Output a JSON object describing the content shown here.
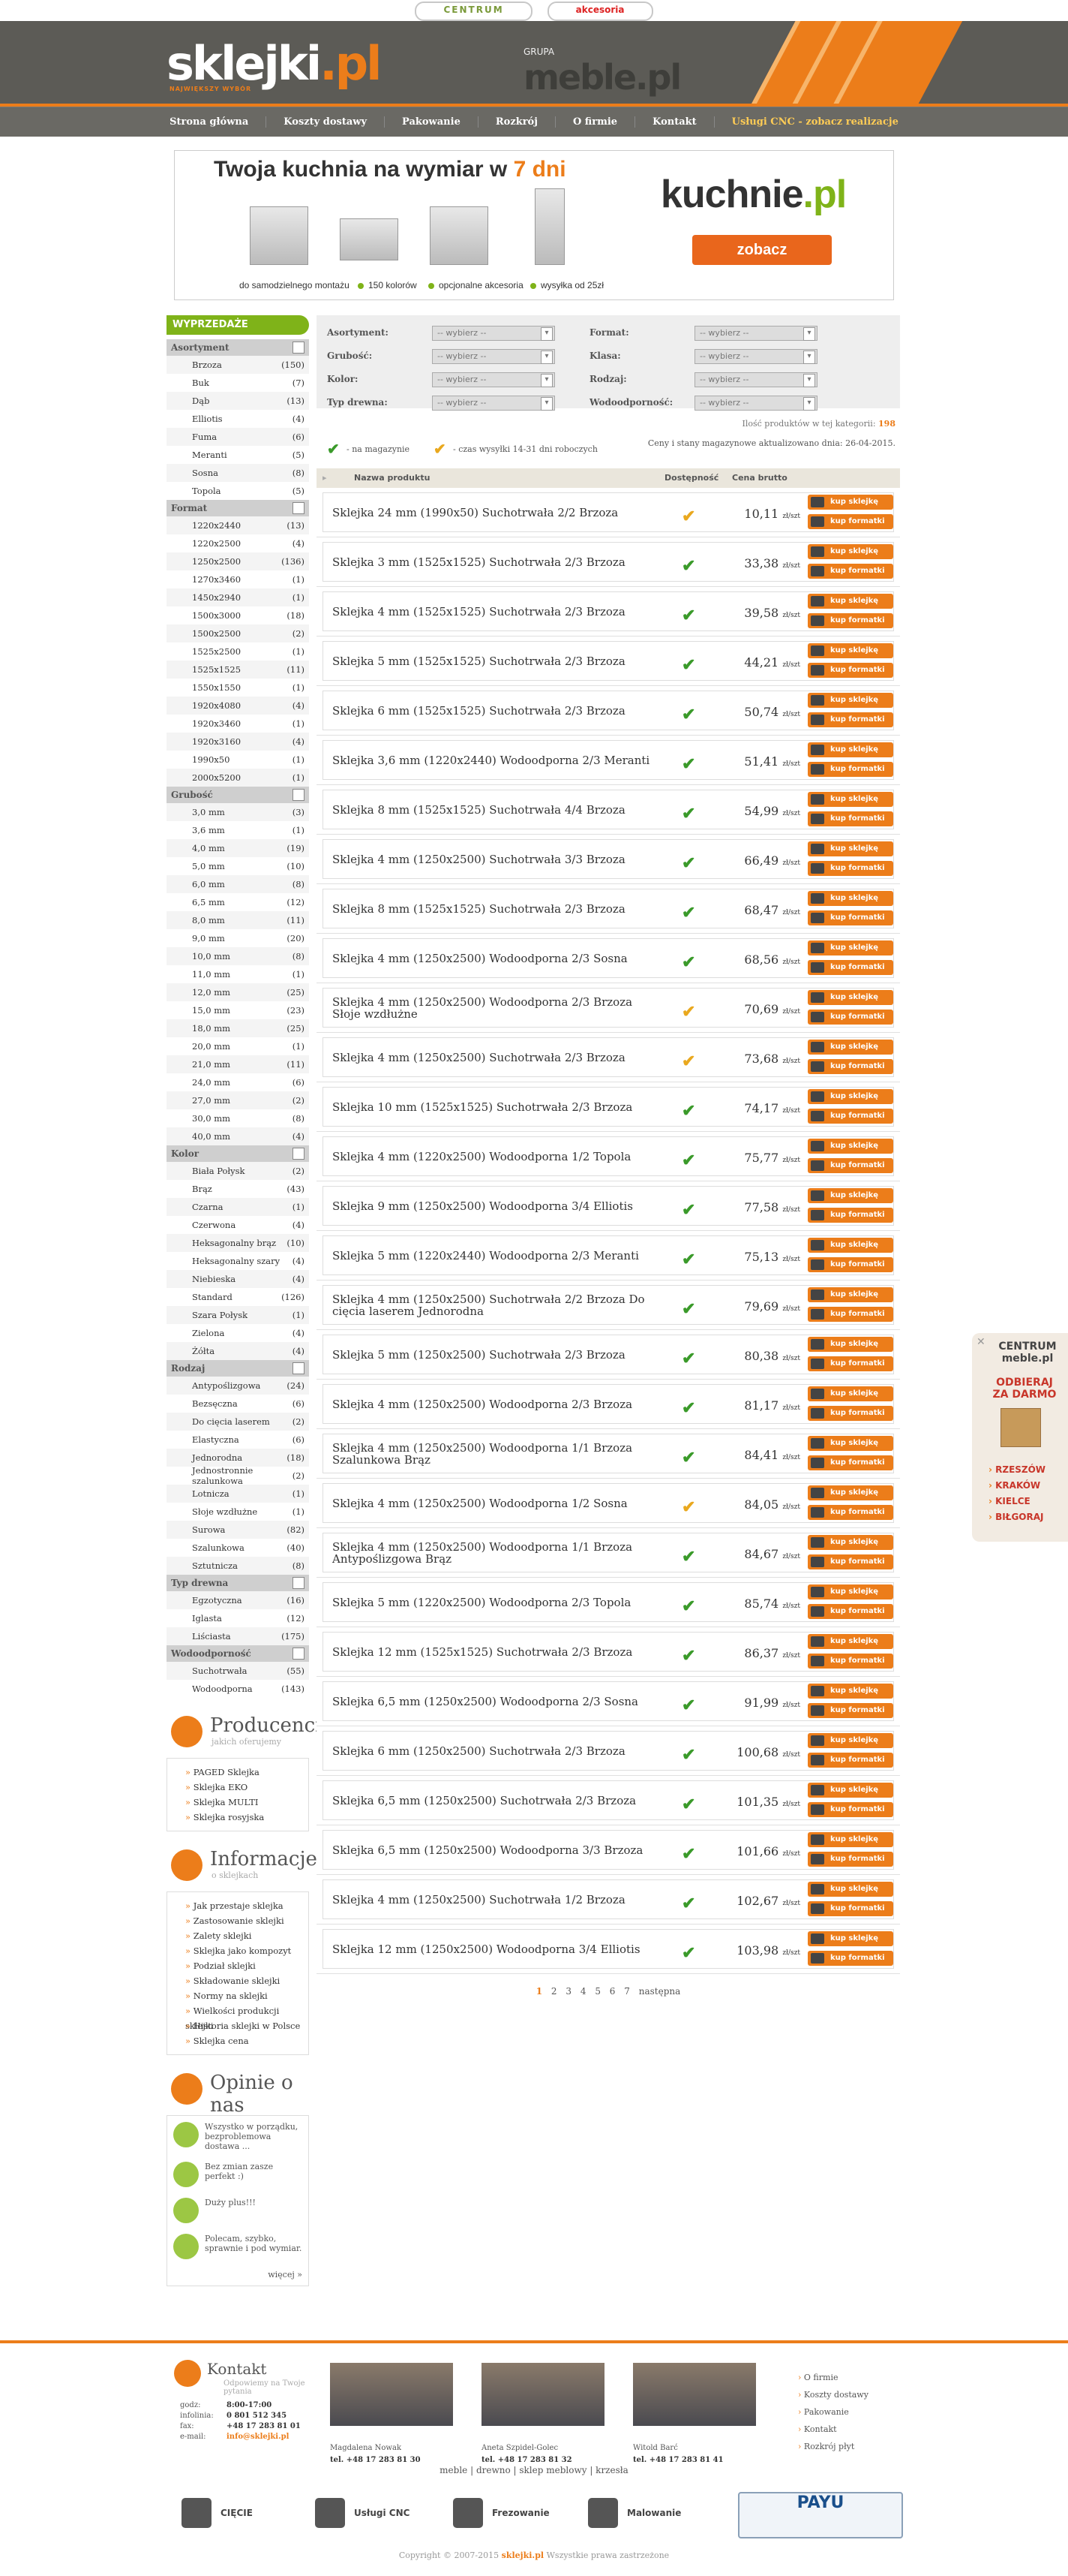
{
  "top": {
    "centrum": "CENTRUM",
    "akcesoria": "akcesoria"
  },
  "header": {
    "logo": "sklejki",
    "logo_dot": ".pl",
    "tagline": "NAJWIĘKSZY WYBÓR",
    "grupa": "GRUPA",
    "meble": "meble.pl"
  },
  "nav": [
    "Strona główna",
    "Koszty dostawy",
    "Pakowanie",
    "Rozkrój",
    "O firmie",
    "Kontakt",
    "Usługi CNC - zobacz realizacje"
  ],
  "banner": {
    "title": "Twoja kuchnia na wymiar w ",
    "title_accent": "7 dni",
    "features": [
      "do samodzielnego montażu",
      "150 kolorów",
      "opcjonalne akcesoria",
      "wysyłka od 25zł"
    ],
    "brand": "kuchnie",
    "brand_dot": ".pl",
    "cta": "zobacz"
  },
  "sidebar": {
    "sale": "WYPRZEDAŻE",
    "groups": [
      {
        "title": "Asortyment",
        "items": [
          [
            "Brzoza",
            "(150)"
          ],
          [
            "Buk",
            "(7)"
          ],
          [
            "Dąb",
            "(13)"
          ],
          [
            "Elliotis",
            "(4)"
          ],
          [
            "Fuma",
            "(6)"
          ],
          [
            "Meranti",
            "(5)"
          ],
          [
            "Sosna",
            "(8)"
          ],
          [
            "Topola",
            "(5)"
          ]
        ]
      },
      {
        "title": "Format",
        "items": [
          [
            "1220x2440",
            "(13)"
          ],
          [
            "1220x2500",
            "(4)"
          ],
          [
            "1250x2500",
            "(136)"
          ],
          [
            "1270x3460",
            "(1)"
          ],
          [
            "1450x2940",
            "(1)"
          ],
          [
            "1500x3000",
            "(18)"
          ],
          [
            "1500x2500",
            "(2)"
          ],
          [
            "1525x2500",
            "(1)"
          ],
          [
            "1525x1525",
            "(11)"
          ],
          [
            "1550x1550",
            "(1)"
          ],
          [
            "1920x4080",
            "(4)"
          ],
          [
            "1920x3460",
            "(1)"
          ],
          [
            "1920x3160",
            "(4)"
          ],
          [
            "1990x50",
            "(1)"
          ],
          [
            "2000x5200",
            "(1)"
          ]
        ]
      },
      {
        "title": "Grubość",
        "items": [
          [
            "3,0 mm",
            "(3)"
          ],
          [
            "3,6 mm",
            "(1)"
          ],
          [
            "4,0 mm",
            "(19)"
          ],
          [
            "5,0 mm",
            "(10)"
          ],
          [
            "6,0 mm",
            "(8)"
          ],
          [
            "6,5 mm",
            "(12)"
          ],
          [
            "8,0 mm",
            "(11)"
          ],
          [
            "9,0 mm",
            "(20)"
          ],
          [
            "10,0 mm",
            "(8)"
          ],
          [
            "11,0 mm",
            "(1)"
          ],
          [
            "12,0 mm",
            "(25)"
          ],
          [
            "15,0 mm",
            "(23)"
          ],
          [
            "18,0 mm",
            "(25)"
          ],
          [
            "20,0 mm",
            "(1)"
          ],
          [
            "21,0 mm",
            "(11)"
          ],
          [
            "24,0 mm",
            "(6)"
          ],
          [
            "27,0 mm",
            "(2)"
          ],
          [
            "30,0 mm",
            "(8)"
          ],
          [
            "40,0 mm",
            "(4)"
          ]
        ]
      },
      {
        "title": "Kolor",
        "items": [
          [
            "Biała Połysk",
            "(2)"
          ],
          [
            "Brąz",
            "(43)"
          ],
          [
            "Czarna",
            "(1)"
          ],
          [
            "Czerwona",
            "(4)"
          ],
          [
            "Heksagonalny brąz",
            "(10)"
          ],
          [
            "Heksagonalny szary",
            "(4)"
          ],
          [
            "Niebieska",
            "(4)"
          ],
          [
            "Standard",
            "(126)"
          ],
          [
            "Szara Połysk",
            "(1)"
          ],
          [
            "Zielona",
            "(4)"
          ],
          [
            "Żółta",
            "(4)"
          ]
        ]
      },
      {
        "title": "Rodzaj",
        "items": [
          [
            "Antypoślizgowa",
            "(24)"
          ],
          [
            "Bezsęcznа",
            "(6)"
          ],
          [
            "Do cięcia laserem",
            "(2)"
          ],
          [
            "Elastyczna",
            "(6)"
          ],
          [
            "Jednorodna",
            "(18)"
          ],
          [
            "Jednostronnie szalunkowa",
            "(2)"
          ],
          [
            "Lotnicza",
            "(1)"
          ],
          [
            "Słoje wzdłużne",
            "(1)"
          ],
          [
            "Surowa",
            "(82)"
          ],
          [
            "Szalunkowa",
            "(40)"
          ],
          [
            "Sztutnicza",
            "(8)"
          ]
        ]
      },
      {
        "title": "Typ drewna",
        "items": [
          [
            "Egzotyczna",
            "(16)"
          ],
          [
            "Iglasta",
            "(12)"
          ],
          [
            "Liściasta",
            "(175)"
          ]
        ]
      },
      {
        "title": "Wodoodporność",
        "items": [
          [
            "Suchotrwała",
            "(55)"
          ],
          [
            "Wodoodporna",
            "(143)"
          ]
        ]
      }
    ],
    "producenci": {
      "title": "Producenci",
      "sub": "jakich oferujemy",
      "items": [
        "PAGED Sklejka",
        "Sklejka EKO",
        "Sklejka MULTI",
        "Sklejka rosyjska"
      ]
    },
    "informacje": {
      "title": "Informacje",
      "sub": "o sklejkach",
      "items": [
        "Jak przestaje sklejka",
        "Zastosowanie sklejki",
        "Zalety sklejki",
        "Sklejka jako kompozyt",
        "Podział sklejki",
        "Składowanie sklejki",
        "Normy na sklejki",
        "Wielkości produkcji sklejki",
        "Historia sklejki w Polsce",
        "Sklejka cena"
      ]
    },
    "opinie": {
      "title": "Opinie o nas",
      "items": [
        "Wszystko w porządku, bezproblemowa dostawa ...",
        "Bez zmian zasze perfekt :)",
        "Duży plus!!!",
        "Polecam, szybko, sprawnie i pod wymiar."
      ],
      "more": "więcej »"
    }
  },
  "filters": {
    "labels": [
      "Asortyment:",
      "Grubość:",
      "Kolor:",
      "Typ drewna:",
      "Format:",
      "Klasa:",
      "Rodzaj:",
      "Wodoodporność:"
    ],
    "placeholder": "-- wybierz --"
  },
  "count": {
    "text": "Ilość produktów w tej kategorii:",
    "value": "198"
  },
  "legend": {
    "in_stock": "- na magazynie",
    "wait": "- czas wysyłki 14-31 dni roboczych",
    "updated": "Ceny i stany magazynowe aktualizowano dnia: 26-04-2015."
  },
  "table": {
    "h_name": "Nazwa produktu",
    "h_avail": "Dostępność",
    "h_price": "Cena brutto",
    "buy": "kup sklejkę",
    "buy2": "kup formatki",
    "unit": "zł/szt"
  },
  "products": [
    {
      "name": "Sklejka 24 mm (1990x50) Suchotrwała 2/2 Brzoza",
      "price": "10,11",
      "avail": "o"
    },
    {
      "name": "Sklejka 3 mm (1525x1525) Suchotrwała 2/3 Brzoza",
      "price": "33,38",
      "avail": "g"
    },
    {
      "name": "Sklejka 4 mm (1525x1525) Suchotrwała 2/3 Brzoza",
      "price": "39,58",
      "avail": "g"
    },
    {
      "name": "Sklejka 5 mm (1525x1525) Suchotrwała 2/3 Brzoza",
      "price": "44,21",
      "avail": "g"
    },
    {
      "name": "Sklejka 6 mm (1525x1525) Suchotrwała 2/3 Brzoza",
      "price": "50,74",
      "avail": "g"
    },
    {
      "name": "Sklejka 3,6 mm (1220x2440) Wodoodporna 2/3 Meranti",
      "price": "51,41",
      "avail": "g"
    },
    {
      "name": "Sklejka 8 mm (1525x1525) Suchotrwała 4/4 Brzoza",
      "price": "54,99",
      "avail": "g"
    },
    {
      "name": "Sklejka 4 mm (1250x2500) Suchotrwała 3/3 Brzoza",
      "price": "66,49",
      "avail": "g"
    },
    {
      "name": "Sklejka 8 mm (1525x1525) Suchotrwała 2/3 Brzoza",
      "price": "68,47",
      "avail": "g"
    },
    {
      "name": "Sklejka 4 mm (1250x2500) Wodoodporna 2/3 Sosna",
      "price": "68,56",
      "avail": "g"
    },
    {
      "name": "Sklejka 4 mm (1250x2500) Wodoodporna 2/3 Brzoza Słoje wzdłużne",
      "price": "70,69",
      "avail": "o"
    },
    {
      "name": "Sklejka 4 mm (1250x2500) Suchotrwała 2/3 Brzoza",
      "price": "73,68",
      "avail": "o"
    },
    {
      "name": "Sklejka 10 mm (1525x1525) Suchotrwała 2/3 Brzoza",
      "price": "74,17",
      "avail": "g"
    },
    {
      "name": "Sklejka 4 mm (1220x2500) Wodoodporna 1/2 Topola",
      "price": "75,77",
      "avail": "g"
    },
    {
      "name": "Sklejka 9 mm (1250x2500) Wodoodporna 3/4 Elliotis",
      "price": "77,58",
      "avail": "g"
    },
    {
      "name": "Sklejka 5 mm (1220x2440) Wodoodporna 2/3 Meranti",
      "price": "75,13",
      "avail": "g"
    },
    {
      "name": "Sklejka 4 mm (1250x2500) Suchotrwała 2/2 Brzoza Do cięcia laserem Jednorodna",
      "price": "79,69",
      "avail": "g"
    },
    {
      "name": "Sklejka 5 mm (1250x2500) Suchotrwała 2/3 Brzoza",
      "price": "80,38",
      "avail": "g"
    },
    {
      "name": "Sklejka 4 mm (1250x2500) Wodoodporna 2/3 Brzoza",
      "price": "81,17",
      "avail": "g"
    },
    {
      "name": "Sklejka 4 mm (1250x2500) Wodoodporna 1/1 Brzoza Szalunkowa Brąz",
      "price": "84,41",
      "avail": "g"
    },
    {
      "name": "Sklejka 4 mm (1250x2500) Wodoodporna 1/2 Sosna",
      "price": "84,05",
      "avail": "o"
    },
    {
      "name": "Sklejka 4 mm (1250x2500) Wodoodporna 1/1 Brzoza Antypoślizgowa Brąz",
      "price": "84,67",
      "avail": "g"
    },
    {
      "name": "Sklejka 5 mm (1220x2500) Wodoodporna 2/3 Topola",
      "price": "85,74",
      "avail": "g"
    },
    {
      "name": "Sklejka 12 mm (1525x1525) Suchotrwała 2/3 Brzoza",
      "price": "86,37",
      "avail": "g"
    },
    {
      "name": "Sklejka 6,5 mm (1250x2500) Wodoodporna 2/3 Sosna",
      "price": "91,99",
      "avail": "g"
    },
    {
      "name": "Sklejka 6 mm (1250x2500) Suchotrwała 2/3 Brzoza",
      "price": "100,68",
      "avail": "g"
    },
    {
      "name": "Sklejka 6,5 mm (1250x2500) Suchotrwała 2/3 Brzoza",
      "price": "101,35",
      "avail": "g"
    },
    {
      "name": "Sklejka 6,5 mm (1250x2500) Wodoodporna 3/3 Brzoza",
      "price": "101,66",
      "avail": "g"
    },
    {
      "name": "Sklejka 4 mm (1250x2500) Suchotrwała 1/2 Brzoza",
      "price": "102,67",
      "avail": "g"
    },
    {
      "name": "Sklejka 12 mm (1250x2500) Wodoodporna 3/4 Elliotis",
      "price": "103,98",
      "avail": "g"
    }
  ],
  "pager": {
    "pages": [
      "1",
      "2",
      "3",
      "4",
      "5",
      "6",
      "7"
    ],
    "next": "następna"
  },
  "sidead": {
    "brand": "CENTRUM meble.pl",
    "headline": "ODBIERAJ ZA DARMO",
    "cities": [
      "RZESZÓW",
      "KRAKÓW",
      "KIELCE",
      "BIŁGORAJ"
    ]
  },
  "footer": {
    "title": "Kontakt",
    "sub": "Odpowiemy na Twoje pytania",
    "hours_l": "godz:",
    "hours": "8:00-17:00",
    "info_l": "infolinia:",
    "info": "0 801 512 345",
    "fax_l": "fax:",
    "fax": "+48 17 283 81 01",
    "mail_l": "e-mail:",
    "mail": "info@sklejki.pl",
    "people": [
      {
        "name": "Magdalena Nowak",
        "tel": "tel. +48 17 283 81 30"
      },
      {
        "name": "Aneta Szpidel-Golec",
        "tel": "tel. +48 17 283 81 32"
      },
      {
        "name": "Witold Barć",
        "tel": "tel. +48 17 283 81 41"
      }
    ],
    "links": [
      "O firmie",
      "Koszty dostawy",
      "Pakowanie",
      "Kontakt",
      "Rozkrój płyt"
    ],
    "bottom": "meble | drewno | sklep meblowy | krzesła",
    "tools": [
      "CIĘCIE",
      "Usługi CNC",
      "Frezowanie",
      "Malowanie"
    ],
    "payu": "PAYU",
    "copy": "Copyright © 2007-2015 ",
    "copy_brand": "sklejki.pl",
    "copy_tail": " Wszystkie prawa zastrzeżone"
  },
  "colors": {
    "accent": "#ec7d1a",
    "green": "#7fb319"
  }
}
